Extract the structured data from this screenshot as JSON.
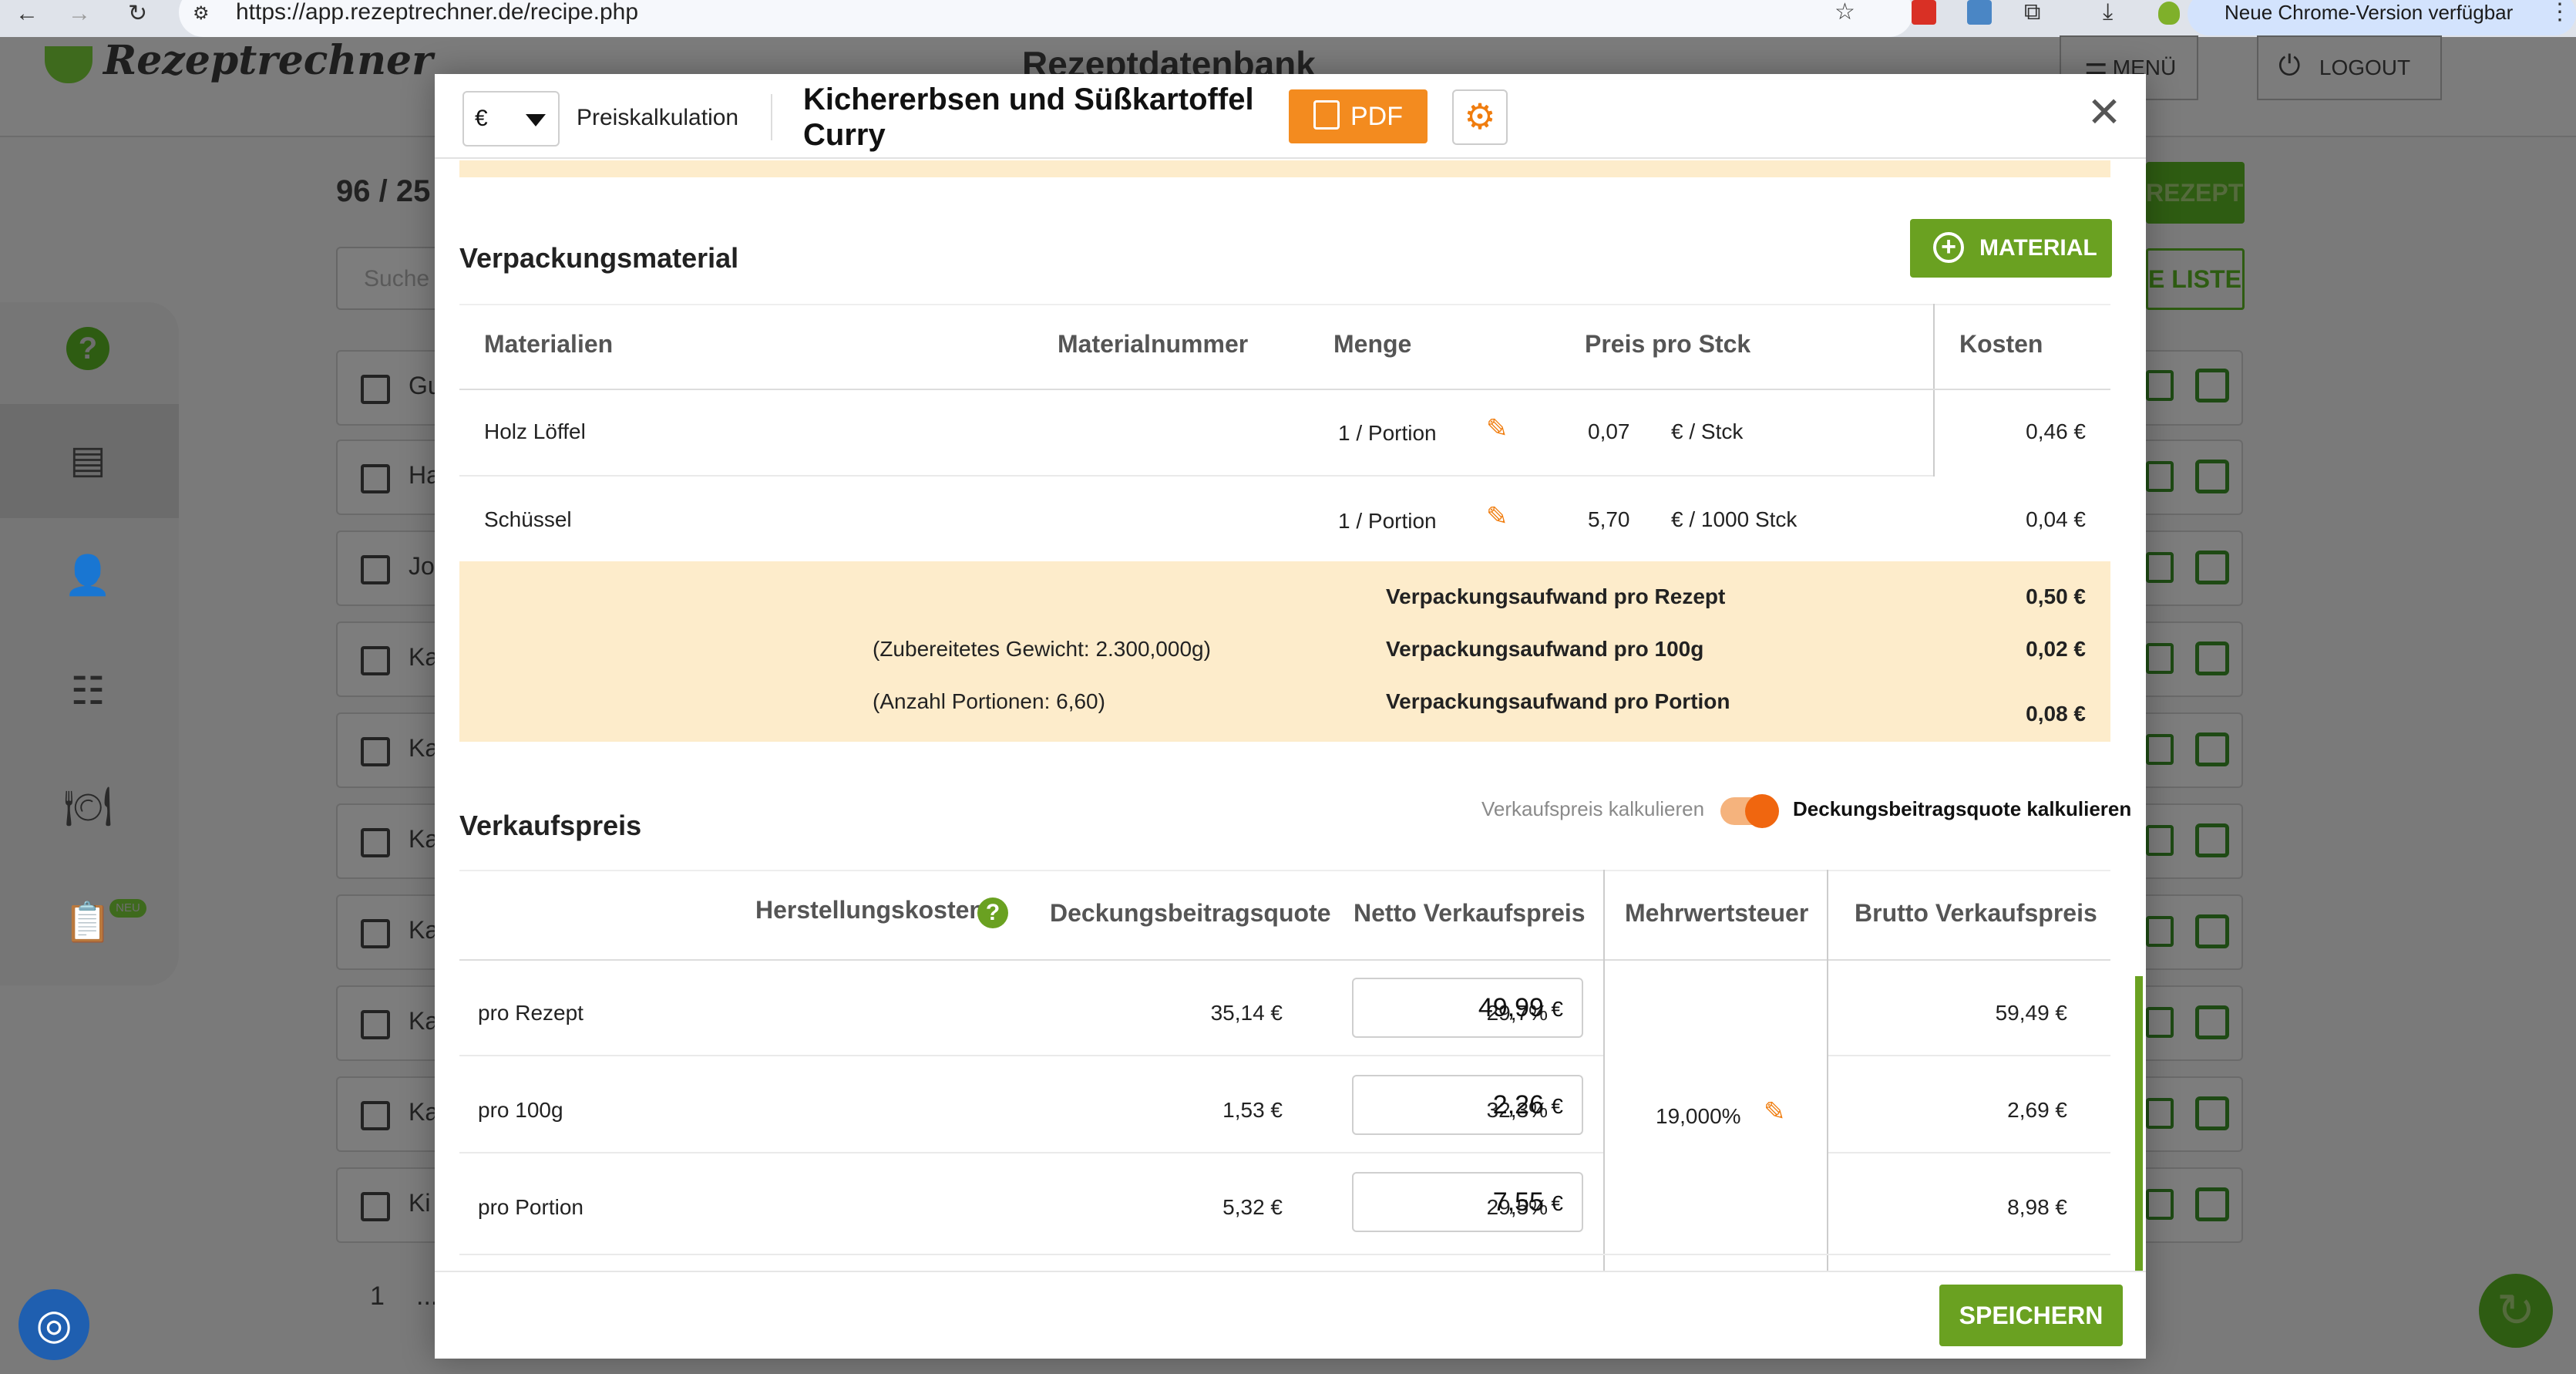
{
  "browser": {
    "url": "https://app.rezeptrechner.de/recipe.php",
    "update_label": "Neue Chrome-Version verfügbar"
  },
  "app": {
    "logo": "Rezeptrechner",
    "page_title": "Rezeptdatenbank",
    "menu_label": "MENÜ",
    "logout_label": "LOGOUT",
    "count": "96 / 25",
    "search_placeholder": "Suche",
    "new_recipe_label": "REZEPT",
    "list_label": "E LISTE",
    "rows": [
      "Gu",
      "Ha",
      "Jo",
      "Ka",
      "Ka",
      "Ka",
      "Ka",
      "Ka",
      "Ka",
      "Ki"
    ],
    "pagination": [
      "1",
      "..."
    ],
    "new_badge": "NEU"
  },
  "modal": {
    "currency": "€",
    "mode": "Preiskalkulation",
    "title": "Kichererbsen und Süßkartoffel Curry",
    "pdf_label": "PDF",
    "save_label": "SPEICHERN",
    "packaging": {
      "title": "Verpackungsmaterial",
      "add_label": "MATERIAL",
      "headers": {
        "material": "Materialien",
        "number": "Materialnummer",
        "amount": "Menge",
        "price": "Preis pro Stck",
        "cost": "Kosten"
      },
      "rows": [
        {
          "name": "Holz Löffel",
          "number": "",
          "amount": "1 / Portion",
          "price": "0,07",
          "unit": "€ / Stck",
          "cost": "0,46 €"
        },
        {
          "name": "Schüssel",
          "number": "",
          "amount": "1 / Portion",
          "price": "5,70",
          "unit": "€ / 1000 Stck",
          "cost": "0,04 €"
        }
      ],
      "summary": {
        "weight_note": "(Zubereitetes Gewicht: 2.300,000g)",
        "portions_note": "(Anzahl Portionen: 6,60)",
        "per_recipe_label": "Verpackungsaufwand pro Rezept",
        "per_recipe_value": "0,50 €",
        "per_100g_label": "Verpackungsaufwand pro 100g",
        "per_100g_value": "0,02 €",
        "per_portion_label": "Verpackungsaufwand pro Portion",
        "per_portion_value": "0,08 €"
      }
    },
    "sales": {
      "title": "Verkaufspreis",
      "toggle_left": "Verkaufspreis kalkulieren",
      "toggle_right": "Deckungsbeitragsquote kalkulieren",
      "headers": {
        "cost": "Herstellungskosten",
        "margin": "Deckungsbeitragsquote",
        "net": "Netto Verkaufspreis",
        "vat": "Mehrwertsteuer",
        "gross": "Brutto Verkaufspreis"
      },
      "vat_value": "19,000%",
      "net_unit": "€",
      "rows": [
        {
          "label": "pro Rezept",
          "cost": "35,14 €",
          "margin": "29,7%",
          "net": "49,99",
          "gross": "59,49 €"
        },
        {
          "label": "pro 100g",
          "cost": "1,53 €",
          "margin": "32,3%",
          "net": "2,26",
          "gross": "2,69 €"
        },
        {
          "label": "pro Portion",
          "cost": "5,32 €",
          "margin": "29,5%",
          "net": "7,55",
          "gross": "8,98 €"
        }
      ]
    }
  }
}
